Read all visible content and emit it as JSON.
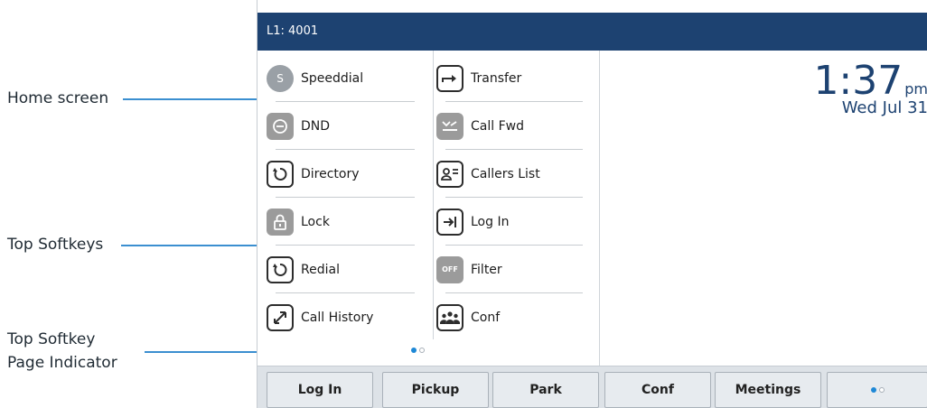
{
  "callouts": {
    "home": "Home screen",
    "top_softkeys": "Top Softkeys",
    "page_indicator_line1": "Top Softkey",
    "page_indicator_line2": "Page Indicator"
  },
  "titlebar": {
    "line": "L1: 4001"
  },
  "grid": {
    "left": [
      {
        "label": "Speeddial",
        "icon": "speeddial-s-icon",
        "glyph": "S"
      },
      {
        "label": "DND",
        "icon": "dnd-icon"
      },
      {
        "label": "Directory",
        "icon": "directory-icon"
      },
      {
        "label": "Lock",
        "icon": "lock-icon"
      },
      {
        "label": "Redial",
        "icon": "redial-icon"
      },
      {
        "label": "Call History",
        "icon": "call-history-icon"
      }
    ],
    "right": [
      {
        "label": "Transfer",
        "icon": "transfer-icon"
      },
      {
        "label": "Call Fwd",
        "icon": "call-forward-icon"
      },
      {
        "label": "Callers List",
        "icon": "callers-list-icon"
      },
      {
        "label": "Log In",
        "icon": "log-in-icon"
      },
      {
        "label": "Filter",
        "icon": "filter-off-icon",
        "glyph": "OFF"
      },
      {
        "label": "Conf",
        "icon": "conference-icon"
      }
    ]
  },
  "clock": {
    "time": "1:37",
    "ampm": "pm",
    "date": "Wed Jul 31"
  },
  "softkeys": [
    "Log In",
    "Pickup",
    "Park",
    "Conf",
    "Meetings"
  ],
  "colors": {
    "titlebar": "#1d4271",
    "accent": "#1e88d6",
    "leader": "#3b8fd0"
  }
}
